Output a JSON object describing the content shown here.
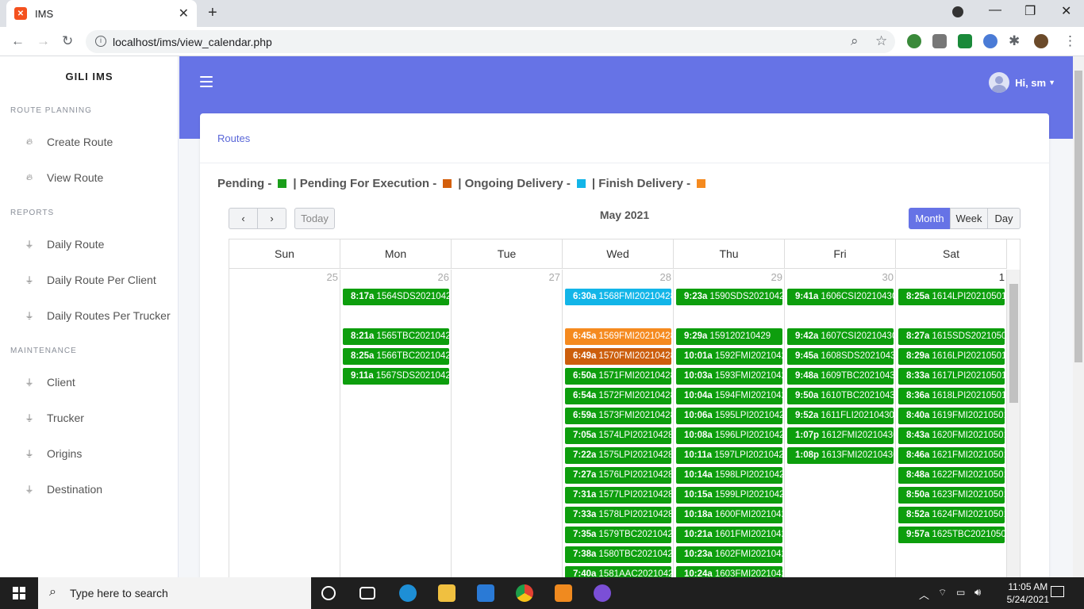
{
  "browser": {
    "tab_title": "IMS",
    "tab_close": "✕",
    "new_tab": "+",
    "url": "localhost/ims/view_calendar.php"
  },
  "sidebar": {
    "brand": "GILI IMS",
    "sections": [
      {
        "title": "ROUTE PLANNING",
        "items": [
          "Create Route",
          "View Route"
        ]
      },
      {
        "title": "REPORTS",
        "items": [
          "Daily Route",
          "Daily Route Per Client",
          "Daily Routes Per Trucker"
        ]
      },
      {
        "title": "MAINTENANCE",
        "items": [
          "Client",
          "Trucker",
          "Origins",
          "Destination"
        ]
      }
    ]
  },
  "topbar": {
    "user": "Hi, sm"
  },
  "card": {
    "breadcrumb": "Routes",
    "legend": [
      {
        "label": "Pending -",
        "color": "#1a9e1a"
      },
      {
        "label": "| Pending For Execution -",
        "color": "#d35f0c"
      },
      {
        "label": "| Ongoing Delivery -",
        "color": "#12b5e8"
      },
      {
        "label": "| Finish Delivery -",
        "color": "#f58a1f"
      }
    ],
    "sep": "|"
  },
  "calendar": {
    "title": "May 2021",
    "prev": "‹",
    "next": "›",
    "today": "Today",
    "views": [
      "Month",
      "Week",
      "Day"
    ],
    "active_view": "Month",
    "daynames": [
      "Sun",
      "Mon",
      "Tue",
      "Wed",
      "Thu",
      "Fri",
      "Sat"
    ],
    "dates": [
      "25",
      "26",
      "27",
      "28",
      "29",
      "30",
      "1"
    ],
    "events": [
      [],
      [
        [
          "8:17a",
          "1564SDS2021042",
          "#0d9e0d"
        ],
        null,
        [
          "8:21a",
          "1565TBC2021042",
          "#0d9e0d"
        ],
        [
          "8:25a",
          "1566TBC2021042",
          "#0d9e0d"
        ],
        [
          "9:11a",
          "1567SDS2021042",
          "#0d9e0d"
        ]
      ],
      [],
      [
        [
          "6:30a",
          "1568FMI20210428",
          "#12b5e8"
        ],
        null,
        [
          "6:45a",
          "1569FMI20210428",
          "#f58a1f"
        ],
        [
          "6:49a",
          "1570FMI20210428",
          "#cc5e0c"
        ],
        [
          "6:50a",
          "1571FMI20210428",
          "#0d9e0d"
        ],
        [
          "6:54a",
          "1572FMI20210428",
          "#0d9e0d"
        ],
        [
          "6:59a",
          "1573FMI20210428",
          "#0d9e0d"
        ],
        [
          "7:05a",
          "1574LPI20210428",
          "#0d9e0d"
        ],
        [
          "7:22a",
          "1575LPI20210428",
          "#0d9e0d"
        ],
        [
          "7:27a",
          "1576LPI20210428",
          "#0d9e0d"
        ],
        [
          "7:31a",
          "1577LPI20210428",
          "#0d9e0d"
        ],
        [
          "7:33a",
          "1578LPI20210428",
          "#0d9e0d"
        ],
        [
          "7:35a",
          "1579TBC2021042",
          "#0d9e0d"
        ],
        [
          "7:38a",
          "1580TBC2021042",
          "#0d9e0d"
        ],
        [
          "7:40a",
          "1581AAC2021042",
          "#0d9e0d"
        ]
      ],
      [
        [
          "9:23a",
          "1590SDS2021042",
          "#0d9e0d"
        ],
        null,
        [
          "9:29a",
          "159120210429",
          "#0d9e0d"
        ],
        [
          "10:01a",
          "1592FMI2021042",
          "#0d9e0d"
        ],
        [
          "10:03a",
          "1593FMI2021042",
          "#0d9e0d"
        ],
        [
          "10:04a",
          "1594FMI2021042",
          "#0d9e0d"
        ],
        [
          "10:06a",
          "1595LPI2021042",
          "#0d9e0d"
        ],
        [
          "10:08a",
          "1596LPI2021042",
          "#0d9e0d"
        ],
        [
          "10:11a",
          "1597LPI2021042",
          "#0d9e0d"
        ],
        [
          "10:14a",
          "1598LPI2021042",
          "#0d9e0d"
        ],
        [
          "10:15a",
          "1599LPI2021042",
          "#0d9e0d"
        ],
        [
          "10:18a",
          "1600FMI2021042",
          "#0d9e0d"
        ],
        [
          "10:21a",
          "1601FMI2021042",
          "#0d9e0d"
        ],
        [
          "10:23a",
          "1602FMI2021042",
          "#0d9e0d"
        ],
        [
          "10:24a",
          "1603FMI2021042",
          "#0d9e0d"
        ]
      ],
      [
        [
          "9:41a",
          "1606CSI20210430",
          "#0d9e0d"
        ],
        null,
        [
          "9:42a",
          "1607CSI20210430",
          "#0d9e0d"
        ],
        [
          "9:45a",
          "1608SDS2021043",
          "#0d9e0d"
        ],
        [
          "9:48a",
          "1609TBC2021043",
          "#0d9e0d"
        ],
        [
          "9:50a",
          "1610TBC2021043",
          "#0d9e0d"
        ],
        [
          "9:52a",
          "1611FLI20210430",
          "#0d9e0d"
        ],
        [
          "1:07p",
          "1612FMI20210430",
          "#0d9e0d"
        ],
        [
          "1:08p",
          "1613FMI20210430",
          "#0d9e0d"
        ]
      ],
      [
        [
          "8:25a",
          "1614LPI20210501",
          "#0d9e0d"
        ],
        null,
        [
          "8:27a",
          "1615SDS2021050",
          "#0d9e0d"
        ],
        [
          "8:29a",
          "1616LPI20210501",
          "#0d9e0d"
        ],
        [
          "8:33a",
          "1617LPI20210501",
          "#0d9e0d"
        ],
        [
          "8:36a",
          "1618LPI20210501",
          "#0d9e0d"
        ],
        [
          "8:40a",
          "1619FMI20210501",
          "#0d9e0d"
        ],
        [
          "8:43a",
          "1620FMI20210501",
          "#0d9e0d"
        ],
        [
          "8:46a",
          "1621FMI20210501",
          "#0d9e0d"
        ],
        [
          "8:48a",
          "1622FMI20210501",
          "#0d9e0d"
        ],
        [
          "8:50a",
          "1623FMI20210501",
          "#0d9e0d"
        ],
        [
          "8:52a",
          "1624FMI20210501",
          "#0d9e0d"
        ],
        [
          "9:57a",
          "1625TBC2021050",
          "#0d9e0d"
        ]
      ]
    ]
  },
  "taskbar": {
    "search": "Type here to search",
    "time": "11:05 AM",
    "date": "5/24/2021"
  }
}
